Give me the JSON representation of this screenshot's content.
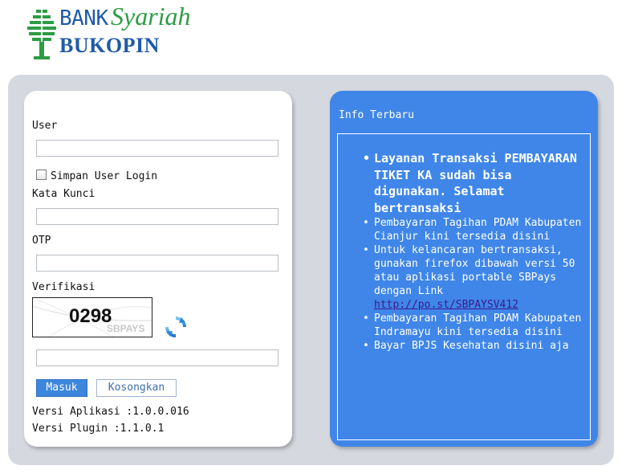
{
  "logo": {
    "bank": "BANK",
    "syariah": "Syariah",
    "bukopin": "BUKOPIN"
  },
  "login": {
    "user_label": "User",
    "user_value": "",
    "remember_label": "Simpan User Login",
    "remember_checked": false,
    "password_label": "Kata Kunci",
    "password_value": "",
    "otp_label": "OTP",
    "otp_value": "",
    "verification_label": "Verifikasi",
    "captcha_code": "0298",
    "captcha_watermark": "SBPAYS",
    "captcha_value": "",
    "submit_label": "Masuk",
    "reset_label": "Kosongkan",
    "app_version": "Versi Aplikasi :1.0.0.016",
    "plugin_version": "Versi Plugin :1.1.0.1"
  },
  "info": {
    "title": "Info Terbaru",
    "items": [
      {
        "text": "Layanan Transaksi PEMBAYARAN TIKET KA sudah bisa digunakan. Selamat bertransaksi"
      },
      {
        "text": "Pembayaran Tagihan PDAM Kabupaten Cianjur kini tersedia disini"
      },
      {
        "text": "Untuk kelancaran bertransaksi, gunakan firefox dibawah versi 50 atau aplikasi portable SBPays dengan Link ",
        "link": "http://po.st/SBPAYSV412"
      },
      {
        "text": "Pembayaran Tagihan PDAM Kabupaten Indramayu kini tersedia disini"
      },
      {
        "text": "Bayar BPJS Kesehatan disini aja"
      }
    ]
  },
  "colors": {
    "info_bg": "#3f86e8",
    "frame_bg": "#d5d8de",
    "logo_blue": "#1f5aa8",
    "logo_green": "#2e9c45",
    "button_primary": "#3d86dd"
  },
  "icons": [
    "bank-tree-logo-icon",
    "refresh-captcha-icon"
  ]
}
